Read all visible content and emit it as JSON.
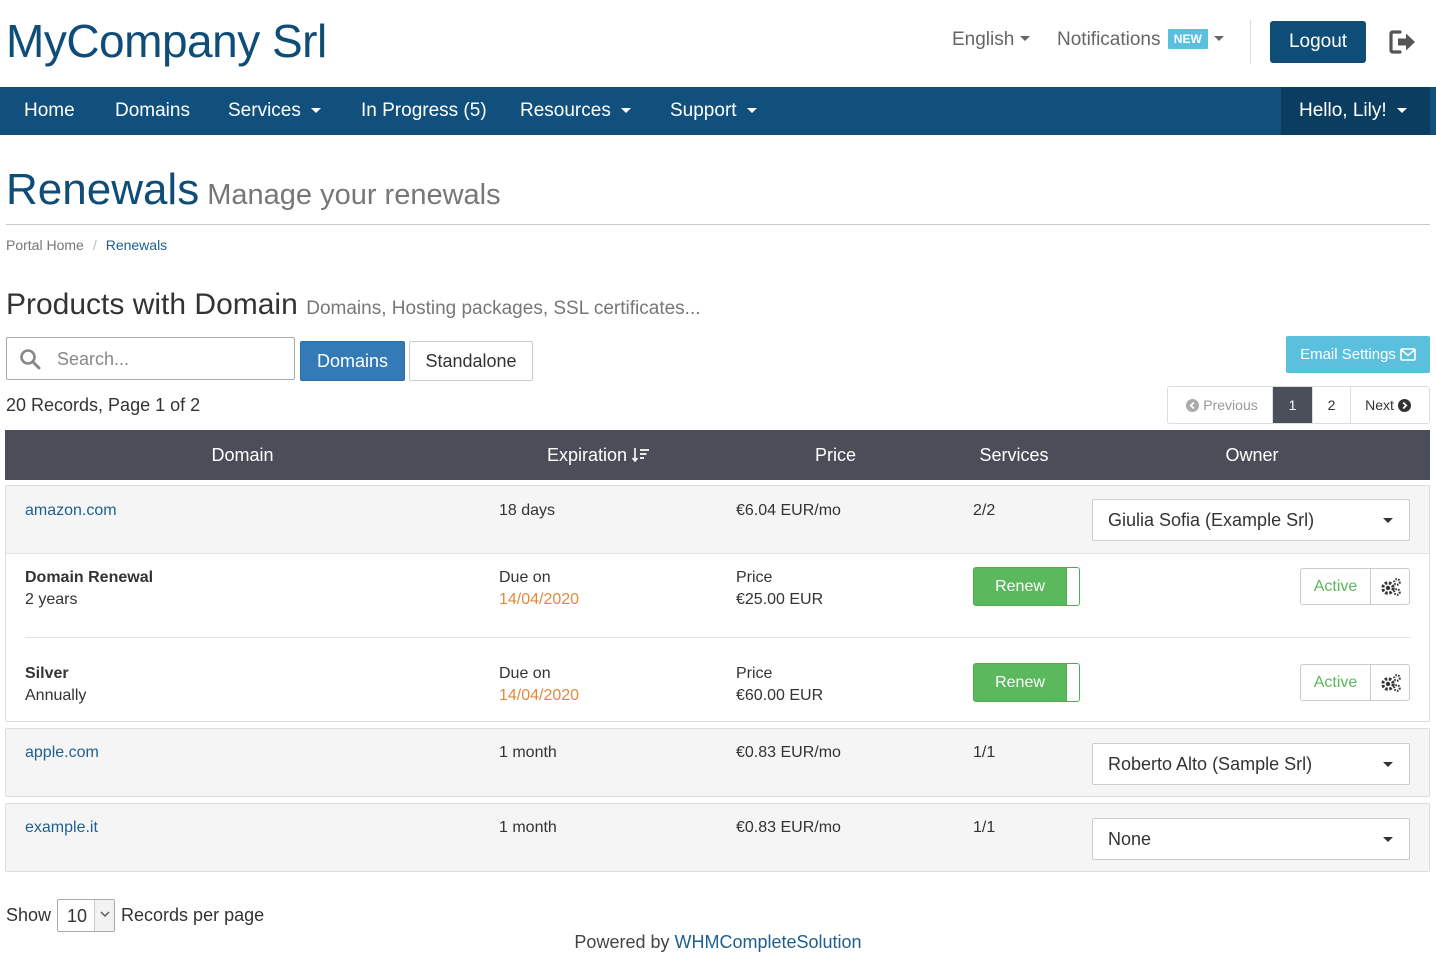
{
  "header": {
    "logo": "MyCompany Srl",
    "language": "English",
    "notifications": "Notifications",
    "notifications_badge": "NEW",
    "logout": "Logout"
  },
  "nav": {
    "home": "Home",
    "domains": "Domains",
    "services": "Services",
    "in_progress": "In Progress (5)",
    "resources": "Resources",
    "support": "Support",
    "greeting": "Hello, Lily!"
  },
  "page": {
    "title": "Renewals",
    "subtitle": "Manage your renewals"
  },
  "breadcrumb": {
    "home": "Portal Home",
    "separator": "/",
    "current": "Renewals"
  },
  "section": {
    "title": "Products with Domain",
    "subtitle": "Domains, Hosting packages, SSL certificates..."
  },
  "toolbar": {
    "search_placeholder": "Search...",
    "domains_label": "Domains",
    "standalone_label": "Standalone",
    "email_settings_label": "Email Settings"
  },
  "records_info": "20 Records, Page 1 of 2",
  "pagination": {
    "previous": "Previous",
    "page1": "1",
    "page2": "2",
    "next": "Next"
  },
  "table": {
    "columns": {
      "domain": "Domain",
      "expiration": "Expiration",
      "price": "Price",
      "services": "Services",
      "owner": "Owner"
    },
    "rows": [
      {
        "domain": "amazon.com",
        "expiration": "18 days",
        "price": "€6.04 EUR/mo",
        "services": "2/2",
        "owner": "Giulia Sofia (Example Srl)",
        "items": [
          {
            "name": "Domain Renewal",
            "period": "2 years",
            "due_label": "Due on",
            "due_date": "14/04/2020",
            "price_label": "Price",
            "price": "€25.00 EUR",
            "renew_label": "Renew",
            "status": "Active"
          },
          {
            "name": "Silver",
            "period": "Annually",
            "due_label": "Due on",
            "due_date": "14/04/2020",
            "price_label": "Price",
            "price": "€60.00 EUR",
            "renew_label": "Renew",
            "status": "Active"
          }
        ]
      },
      {
        "domain": "apple.com",
        "expiration": "1 month",
        "price": "€0.83 EUR/mo",
        "services": "1/1",
        "owner": "Roberto Alto (Sample Srl)"
      },
      {
        "domain": "example.it",
        "expiration": "1 month",
        "price": "€0.83 EUR/mo",
        "services": "1/1",
        "owner": "None"
      }
    ]
  },
  "footer": {
    "show_label": "Show",
    "per_page_value": "10",
    "per_page_suffix": "Records per page",
    "powered_by": "Powered by",
    "powered_link": "WHMCompleteSolution"
  },
  "colors": {
    "brand": "#0f4d79",
    "navbar": "#11507d",
    "table_header": "#4b4e59",
    "renew_green": "#5cb85c",
    "due_date_orange": "#e08a3a",
    "info_blue": "#5bc0de",
    "primary_blue": "#337ab7"
  },
  "icons": {
    "language_caret": "chevron-down-icon",
    "exit": "sign-out-icon",
    "search": "search-icon",
    "email": "envelope-icon",
    "sort": "sort-desc-icon",
    "previous": "arrow-circle-left-icon",
    "next": "arrow-circle-right-icon",
    "gear": "cogs-icon"
  }
}
